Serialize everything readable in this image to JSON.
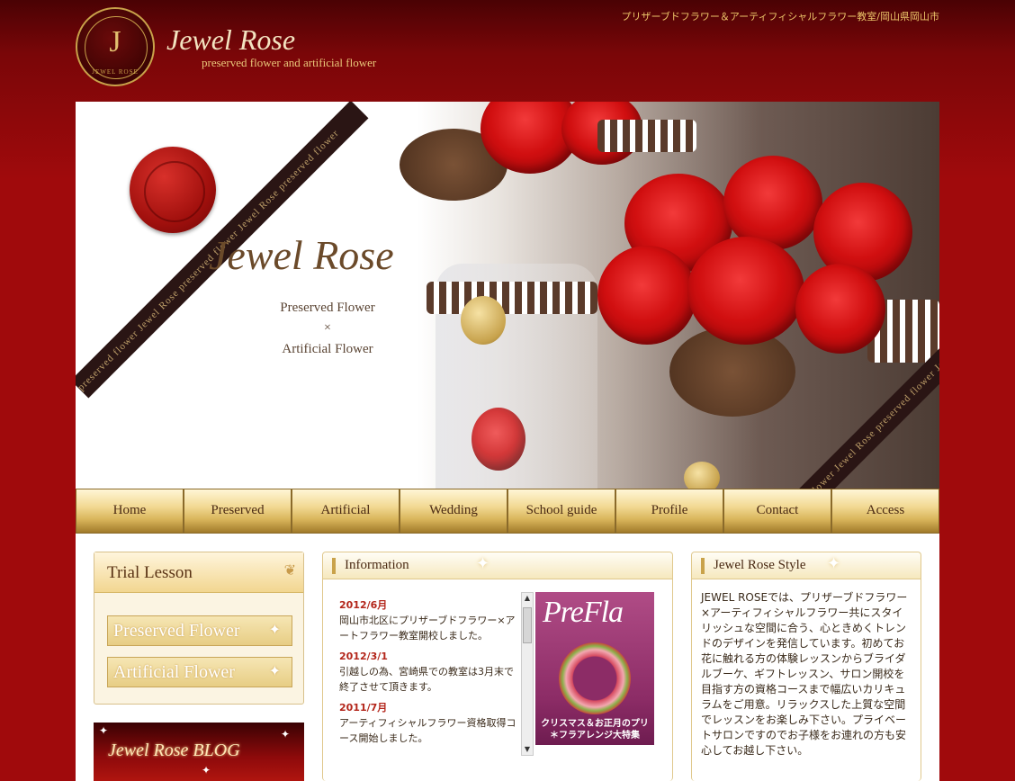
{
  "header": {
    "logo_letter": "J",
    "logo_sub": "JEWEL ROSE",
    "logo_title": "Jewel Rose",
    "logo_tagline": "preserved flower and artificial flower",
    "tagline": "プリザーブドフラワー＆アーティフィシャルフラワー教室/岡山県岡山市"
  },
  "hero": {
    "title": "Jewel Rose",
    "line1": "Preserved Flower",
    "times": "×",
    "line2": "Artificial Flower",
    "ribbon_text": "preserved flower Jewel Rose preserved flower Jewel Rose preserved flower"
  },
  "nav": {
    "items": [
      "Home",
      "Preserved",
      "Artificial",
      "Wedding",
      "School guide",
      "Profile",
      "Contact",
      "Access"
    ]
  },
  "trial": {
    "title": "Trial Lesson",
    "buttons": [
      "Preserved Flower",
      "Artificial Flower"
    ]
  },
  "blog": {
    "label": "Jewel Rose BLOG"
  },
  "info": {
    "title": "Information",
    "news": [
      {
        "date": "2012/6月",
        "text": "岡山市北区にプリザーブドフラワー×アートフラワー教室開校しました。"
      },
      {
        "date": "2012/3/1",
        "text": "引越しの為、宮崎県での教室は3月末で終了させて頂きます。"
      },
      {
        "date": "2011/7月",
        "text": "アーティフィシャルフラワー資格取得コース開始しました。"
      }
    ],
    "magazine_title": "PreFla",
    "magazine_caption": "クリスマス＆お正月のプリ＊フラアレンジ大特集"
  },
  "style": {
    "title": "Jewel Rose Style",
    "body": "JEWEL ROSEでは、プリザーブドフラワー×アーティフィシャルフラワー共にスタイリッシュな空間に合う、心ときめくトレンドのデザインを発信しています。初めてお花に触れる方の体験レッスンからブライダルブーケ、ギフトレッスン、サロン開校を目指す方の資格コースまで幅広いカリキュラムをご用意。リラックスした上質な空間でレッスンをお楽しみ下さい。プライベートサロンですのでお子様をお連れの方も安心してお越し下さい。"
  },
  "colors": {
    "background": "#a00a0c",
    "gold": "#c9a24a",
    "nav_gold": "#d8b45a",
    "date_red": "#b3251a"
  }
}
